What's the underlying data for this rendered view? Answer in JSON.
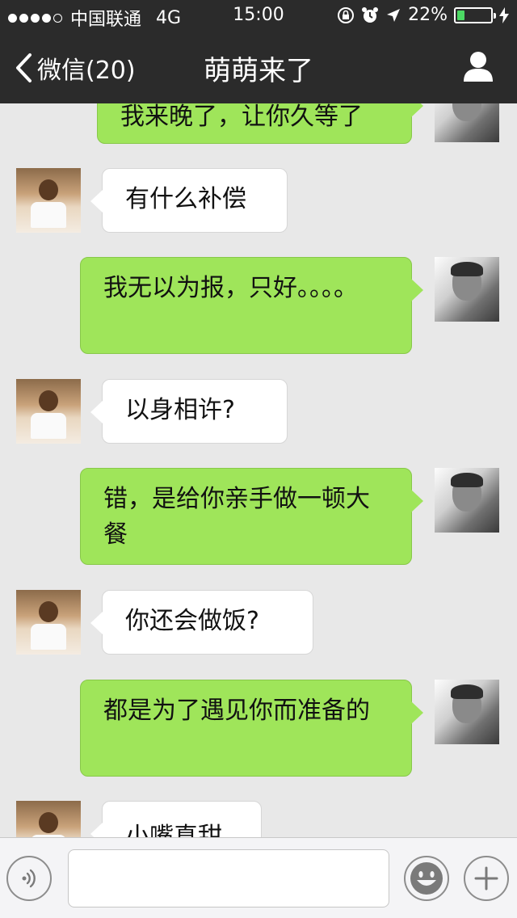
{
  "status_bar": {
    "signal_dots": 5,
    "signal_filled": 4,
    "carrier": "中国联通",
    "network": "4G",
    "time": "15:00",
    "icons": [
      "orientation-lock-icon",
      "alarm-icon",
      "location-arrow-icon"
    ],
    "battery_percent": "22%",
    "battery_level": 0.22,
    "charging": true
  },
  "nav": {
    "back_label": "微信(20)",
    "title": "萌萌来了",
    "profile_icon": "person-icon"
  },
  "messages": [
    {
      "sender": "me",
      "text": "我来晚了，让你久等了"
    },
    {
      "sender": "friend",
      "text": "有什么补偿"
    },
    {
      "sender": "me",
      "text": "我无以为报，只好。。。。"
    },
    {
      "sender": "friend",
      "text": "以身相许?"
    },
    {
      "sender": "me",
      "text": "错，是给你亲手做一顿大餐"
    },
    {
      "sender": "friend",
      "text": "你还会做饭?"
    },
    {
      "sender": "me",
      "text": "都是为了遇见你而准备的"
    },
    {
      "sender": "friend",
      "text": "小嘴真甜"
    }
  ],
  "input_bar": {
    "voice_icon": "voice-icon",
    "text_value": "",
    "emoji_icon": "smiley-icon",
    "more_icon": "plus-icon"
  },
  "colors": {
    "bar_bg": "#2b2b2b",
    "chat_bg": "#e8e8e8",
    "my_bubble": "#9fe55a",
    "friend_bubble": "#ffffff",
    "battery_fill": "#4cd964"
  }
}
